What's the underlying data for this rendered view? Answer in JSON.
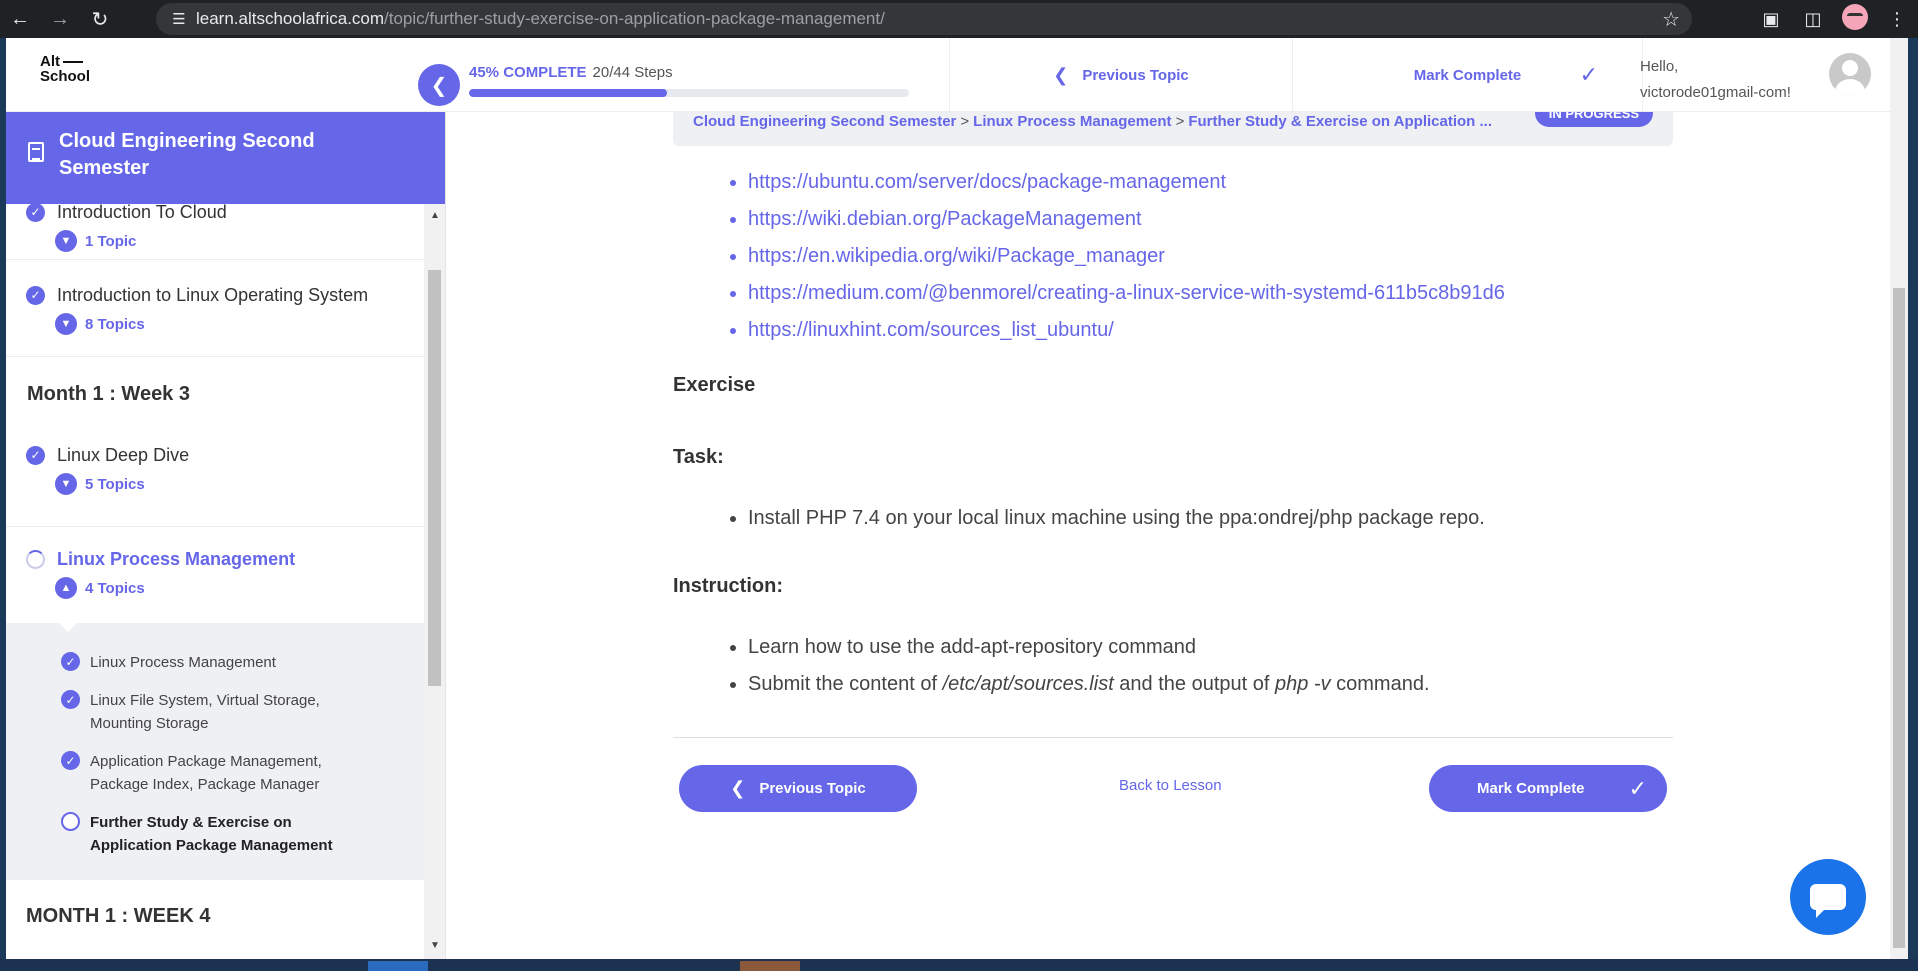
{
  "browser": {
    "url_host": "learn.altschoolafrica.com",
    "url_path": "/topic/further-study-exercise-on-application-package-management/"
  },
  "header": {
    "logo_line1": "Alt",
    "logo_line2": "School",
    "progress_percent_label": "45% COMPLETE",
    "progress_steps": "20/44 Steps",
    "progress_fraction": 0.45,
    "prev_topic": "Previous Topic",
    "mark_complete": "Mark Complete",
    "hello": "Hello,",
    "username": "victorode01gmail-com!"
  },
  "sidebar": {
    "course_title": "Cloud Engineering Second Semester",
    "lessons": [
      {
        "name": "Introduction To Cloud",
        "topics": "1 Topic"
      },
      {
        "name": "Introduction to Linux Operating System",
        "topics": "8 Topics"
      }
    ],
    "week3": "Month 1 : Week 3",
    "week3_lessons": [
      {
        "name": "Linux Deep Dive",
        "topics": "5 Topics"
      },
      {
        "name": "Linux Process Management",
        "topics": "4 Topics"
      }
    ],
    "subtopics": [
      "Linux Process Management",
      "Linux File System, Virtual Storage, Mounting Storage",
      "Application Package Management, Package Index, Package Manager",
      "Further Study & Exercise on Application Package Management"
    ],
    "week4": "MONTH 1 : WEEK 4"
  },
  "breadcrumb": {
    "course": "Cloud Engineering Second Semester",
    "lesson": "Linux Process Management",
    "topic": "Further Study & Exercise on Application ...",
    "status": "IN PROGRESS"
  },
  "content": {
    "links": [
      "https://ubuntu.com/server/docs/package-management",
      "https://wiki.debian.org/PackageManagement",
      "https://en.wikipedia.org/wiki/Package_manager",
      "https://medium.com/@benmorel/creating-a-linux-service-with-systemd-611b5c8b91d6",
      "https://linuxhint.com/sources_list_ubuntu/"
    ],
    "exercise_heading": "Exercise",
    "task_heading": "Task:",
    "task_item": "Install PHP 7.4 on your local linux machine using the ppa:ondrej/php package repo.",
    "instruction_heading": "Instruction:",
    "instruction_item1": "Learn how to use the add-apt-repository command",
    "instruction_item2_a": "Submit the content of ",
    "instruction_item2_b": "/etc/apt/sources.list",
    "instruction_item2_c": " and the output of ",
    "instruction_item2_d": "php -v",
    "instruction_item2_e": " command."
  },
  "footer_nav": {
    "prev": "Previous Topic",
    "back": "Back to Lesson",
    "mark": "Mark Complete"
  },
  "colors": {
    "accent": "#6566e8",
    "chat": "#1a73e8"
  }
}
